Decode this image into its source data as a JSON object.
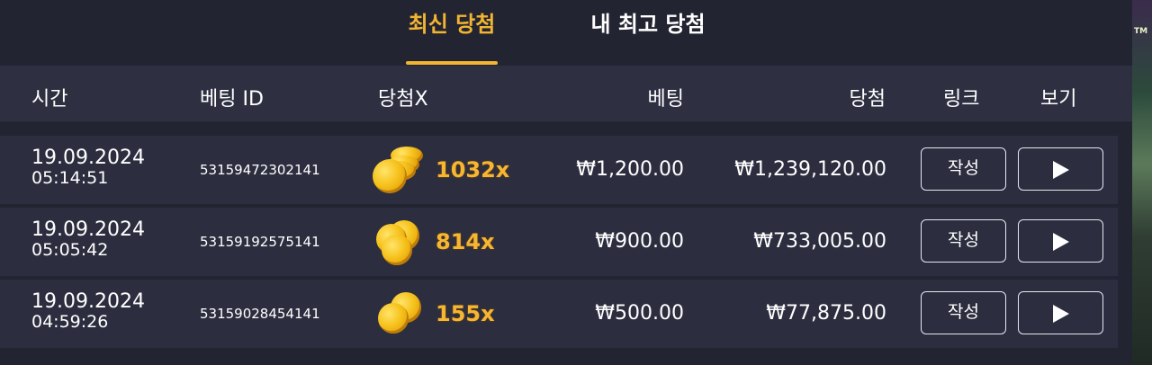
{
  "tabs": {
    "latest": "최신 당첨",
    "my_best": "내 최고 당첨",
    "active_color": "#f2b531"
  },
  "columns": {
    "time": "시간",
    "bet_id": "베팅 ID",
    "multiplier": "당첨X",
    "bet": "베팅",
    "win": "당첨",
    "link": "링크",
    "view": "보기"
  },
  "rows": [
    {
      "date": "19.09.2024",
      "time": "05:14:51",
      "bet_id": "53159472302141",
      "multiplier": "1032x",
      "bet": "₩1,200.00",
      "win": "₩1,239,120.00",
      "write_label": "작성",
      "coin_icon": "gold-coin-stack-icon",
      "view_icon": "play-icon"
    },
    {
      "date": "19.09.2024",
      "time": "05:05:42",
      "bet_id": "53159192575141",
      "multiplier": "814x",
      "bet": "₩900.00",
      "win": "₩733,005.00",
      "write_label": "작성",
      "coin_icon": "gold-coins-icon",
      "view_icon": "play-icon"
    },
    {
      "date": "19.09.2024",
      "time": "04:59:26",
      "bet_id": "53159028454141",
      "multiplier": "155x",
      "bet": "₩500.00",
      "win": "₩77,875.00",
      "write_label": "작성",
      "coin_icon": "gold-coins-icon",
      "view_icon": "play-icon"
    }
  ],
  "side_strip": {
    "text": "TM"
  }
}
